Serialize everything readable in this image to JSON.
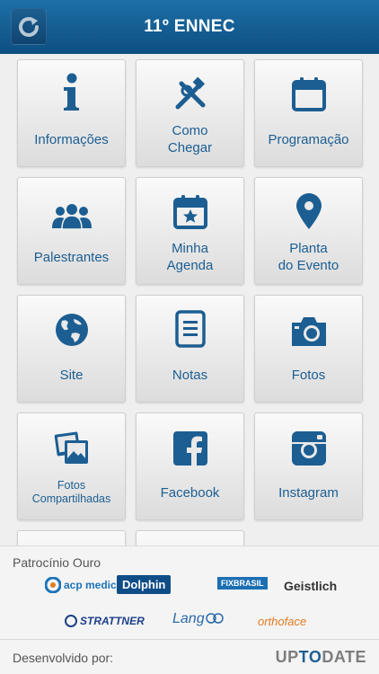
{
  "header": {
    "title": "11º ENNEC"
  },
  "tiles": [
    {
      "label": "Informações",
      "icon": "info-icon"
    },
    {
      "label": "Como\nChegar",
      "icon": "map-pin-tools-icon"
    },
    {
      "label": "Programação",
      "icon": "calendar-icon"
    },
    {
      "label": "Palestrantes",
      "icon": "people-icon"
    },
    {
      "label": "Minha\nAgenda",
      "icon": "calendar-star-icon"
    },
    {
      "label": "Planta\ndo Evento",
      "icon": "location-pin-icon"
    },
    {
      "label": "Site",
      "icon": "globe-icon"
    },
    {
      "label": "Notas",
      "icon": "notes-icon"
    },
    {
      "label": "Fotos",
      "icon": "camera-icon"
    },
    {
      "label": "Fotos\nCompartilhadas",
      "icon": "photos-stack-icon"
    },
    {
      "label": "Facebook",
      "icon": "facebook-icon"
    },
    {
      "label": "Instagram",
      "icon": "instagram-icon"
    }
  ],
  "sponsors": {
    "heading": "Patrocínio Ouro",
    "logos": [
      {
        "name": "acp medic"
      },
      {
        "name": "Dolphin"
      },
      {
        "name": "FIXBRASIL"
      },
      {
        "name": "Geistlich"
      },
      {
        "name": "STRATTNER"
      },
      {
        "name": "Lang"
      },
      {
        "name": "orthoface"
      }
    ]
  },
  "developer": {
    "label": "Desenvolvido por:",
    "brand_a": "UP",
    "brand_b": "TO",
    "brand_c": "DATE"
  },
  "colors": {
    "primary": "#1c5e92",
    "header": "#0d4f80"
  }
}
